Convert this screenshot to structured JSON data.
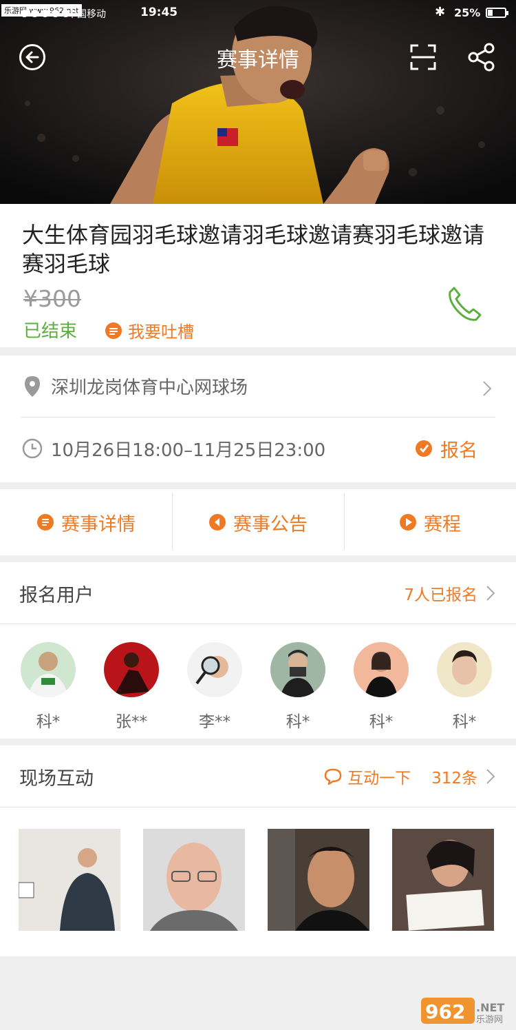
{
  "status_bar": {
    "watermark": "乐游网 www.962.net",
    "carrier": "中国移动",
    "time": "19:45",
    "battery": "25%"
  },
  "nav": {
    "title": "赛事详情"
  },
  "event": {
    "title": "大生体育园羽毛球邀请羽毛球邀请赛羽毛球邀请赛羽毛球",
    "price": "¥300",
    "status": "已结束",
    "complain_label": "我要吐槽"
  },
  "location": "深圳龙岗体育中心网球场",
  "time_range": "10月26日18:00–11月25日23:00",
  "signup_label": "报名",
  "tabs": [
    {
      "label": "赛事详情",
      "icon": "doc-icon"
    },
    {
      "label": "赛事公告",
      "icon": "announce-icon"
    },
    {
      "label": "赛程",
      "icon": "play-icon"
    }
  ],
  "registered": {
    "title": "报名用户",
    "count_label": "7人已报名",
    "users": [
      {
        "name": "科*"
      },
      {
        "name": "张**"
      },
      {
        "name": "李**"
      },
      {
        "name": "科*"
      },
      {
        "name": "科*"
      },
      {
        "name": "科*"
      }
    ]
  },
  "interaction": {
    "title": "现场互动",
    "action_label": "互动一下",
    "count_label": "312条"
  },
  "colors": {
    "accent": "#f07a24",
    "ended": "#5cae3c"
  },
  "watermark_bottom": "962.NET 乐游网"
}
